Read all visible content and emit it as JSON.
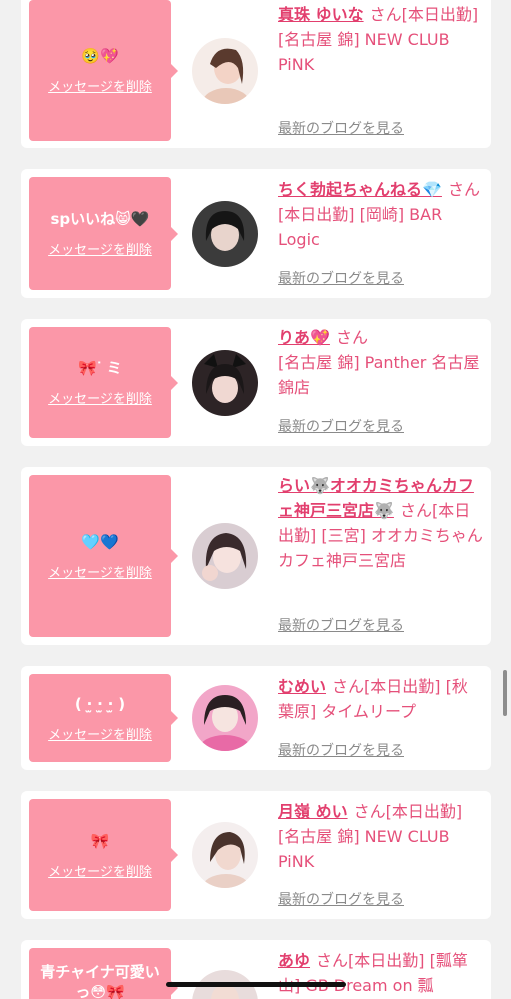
{
  "delete_label": "メッセージを削除",
  "blog_label": "最新のブログを見る",
  "san_label": "さん",
  "colors": {
    "bubble": "#fb97a8",
    "name": "#e23f6e",
    "text": "#e5507a",
    "link_gray": "#8a8a8a"
  },
  "items": [
    {
      "message": "🥹💖",
      "name": "真珠 ゆいな",
      "details": "[本日出勤] [名古屋 錦] NEW CLUB PiNK",
      "avatar": "avatar-icon"
    },
    {
      "message": "spいいね😸🖤",
      "name": "ちく勃起ちゃんねる💎",
      "details": "[本日出勤] [岡崎] BAR Logic",
      "avatar": "avatar-icon"
    },
    {
      "message": "🎀ᐝ ミ",
      "name": "りあ💖",
      "details": "[名古屋 錦] Panther 名古屋錦店",
      "avatar": "avatar-icon"
    },
    {
      "message": "🩵💙",
      "name": "らい🐺オオカミちゃんカフェ神戸三宮店🐺",
      "details": "[本日出勤] [三宮] オオカミちゃんカフェ神戸三宮店",
      "avatar": "avatar-icon"
    },
    {
      "message": "( ‧̫ ‧̫ ‧̫ )",
      "name": "むめい",
      "details": "[本日出勤] [秋葉原] タイムリープ",
      "avatar": "avatar-icon"
    },
    {
      "message": "🎀",
      "name": "月嶺 めい",
      "details": "[本日出勤] [名古屋 錦] NEW CLUB PiNK",
      "avatar": "avatar-icon"
    },
    {
      "message": "青チャイナ可愛い っ😳🎀",
      "name": "あゆ",
      "details": "[本日出勤] [瓢箪山] GB Dream on 瓢",
      "avatar": "avatar-icon"
    }
  ]
}
